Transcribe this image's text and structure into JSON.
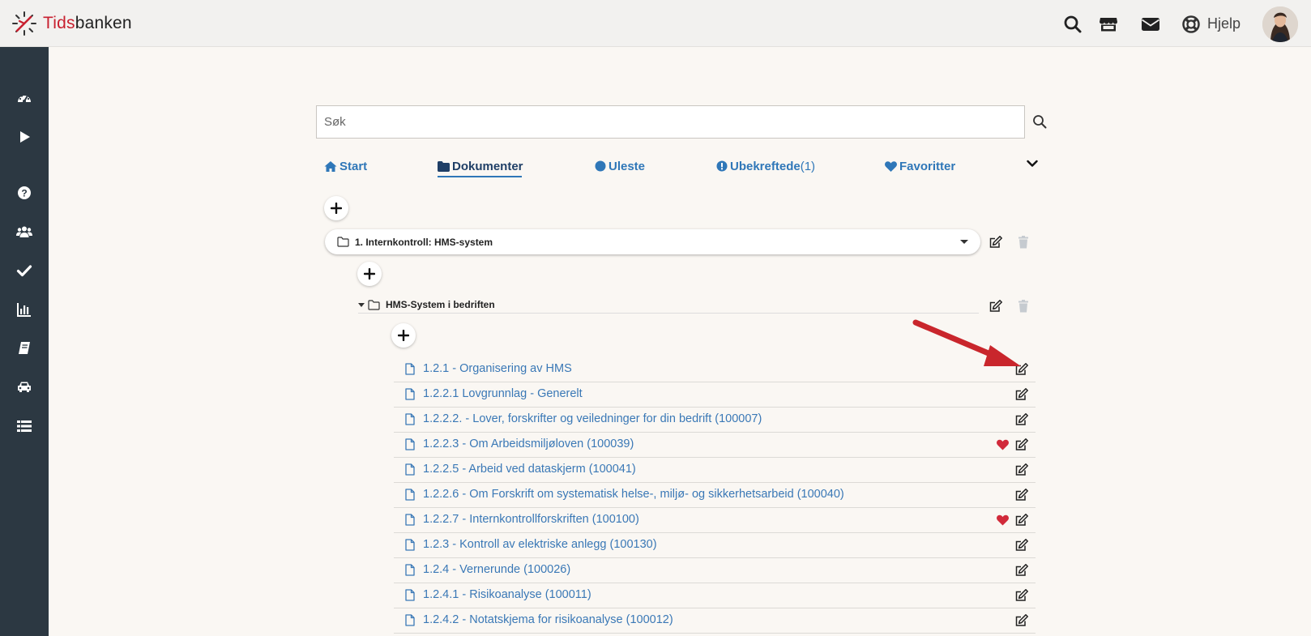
{
  "app": {
    "logo_prefix": "Tids",
    "logo_suffix": "banken",
    "help_label": "Hjelp"
  },
  "topbar_icons": [
    "search-icon",
    "store-icon",
    "envelope-icon",
    "lifebuoy-icon"
  ],
  "sidebar_icons": [
    "dashboard-icon",
    "play-icon",
    "question-icon",
    "users-icon",
    "check-icon",
    "bar-chart-icon",
    "book-icon",
    "car-icon",
    "list-icon"
  ],
  "search": {
    "placeholder": "Søk"
  },
  "tabs": [
    {
      "label": "Start",
      "icon": "home-icon"
    },
    {
      "label": "Dokumenter",
      "icon": "folder-icon"
    },
    {
      "label": "Uleste",
      "icon": "circle-icon"
    },
    {
      "label": "Ubekreftede",
      "count": "(1)",
      "icon": "exclamation-icon"
    },
    {
      "label": "Favoritter",
      "icon": "heart-icon"
    }
  ],
  "active_tab": "Dokumenter",
  "folder": {
    "name": "1. Internkontroll: HMS-system"
  },
  "subfolder": {
    "name": "HMS-System i bedriften"
  },
  "documents": [
    {
      "title": "1.2.1 - Organisering av HMS",
      "favorite": false
    },
    {
      "title": "1.2.2.1 Lovgrunnlag - Generelt",
      "favorite": false
    },
    {
      "title": "1.2.2.2. - Lover, forskrifter og veiledninger for din bedrift (100007)",
      "favorite": false
    },
    {
      "title": "1.2.2.3 - Om Arbeidsmiljøloven (100039)",
      "favorite": true
    },
    {
      "title": "1.2.2.5 - Arbeid ved dataskjerm (100041)",
      "favorite": false
    },
    {
      "title": "1.2.2.6 - Om Forskrift om systematisk helse-, miljø- og sikkerhetsarbeid (100040)",
      "favorite": false
    },
    {
      "title": "1.2.2.7 - Internkontrollforskriften (100100)",
      "favorite": true
    },
    {
      "title": "1.2.3 - Kontroll av elektriske anlegg (100130)",
      "favorite": false
    },
    {
      "title": "1.2.4 - Vernerunde (100026)",
      "favorite": false
    },
    {
      "title": "1.2.4.1 - Risikoanalyse (100011)",
      "favorite": false
    },
    {
      "title": "1.2.4.2 - Notatskjema for risikoanalyse (100012)",
      "favorite": false
    }
  ],
  "colors": {
    "accent": "#2f77b8",
    "sidebar": "#2c3842",
    "heart": "#d12a3a",
    "arrow": "#c9262c",
    "logo_red": "#c8202f"
  }
}
